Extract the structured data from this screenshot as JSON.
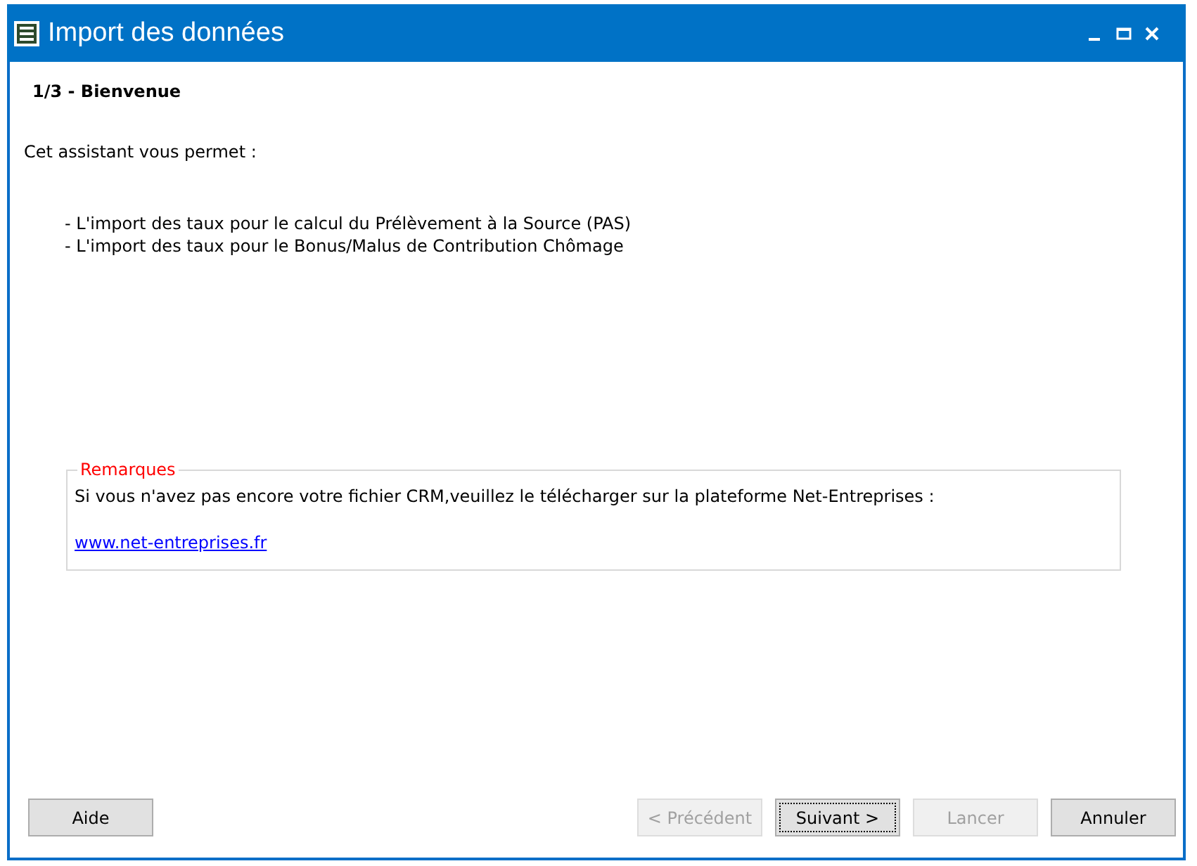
{
  "window": {
    "title": "Import des données"
  },
  "step": "1/3 - Bienvenue",
  "intro": "Cet assistant vous permet :",
  "items": [
    "- L'import des taux pour le calcul du Prélèvement à la Source (PAS)",
    "- L'import des taux pour le Bonus/Malus de Contribution Chômage"
  ],
  "remarks": {
    "legend": "Remarques",
    "text": "Si vous n'avez pas encore votre fichier CRM,veuillez le télécharger sur la plateforme Net-Entreprises :",
    "link": "www.net-entreprises.fr"
  },
  "help_button": {
    "label": "Aide",
    "disabled": false,
    "focused": false
  },
  "buttons": [
    {
      "label": "< Précédent",
      "disabled": true,
      "focused": false
    },
    {
      "label": "Suivant >",
      "disabled": false,
      "focused": true
    },
    {
      "label": "Lancer",
      "disabled": true,
      "focused": false
    },
    {
      "label": "Annuler",
      "disabled": false,
      "focused": false
    }
  ]
}
